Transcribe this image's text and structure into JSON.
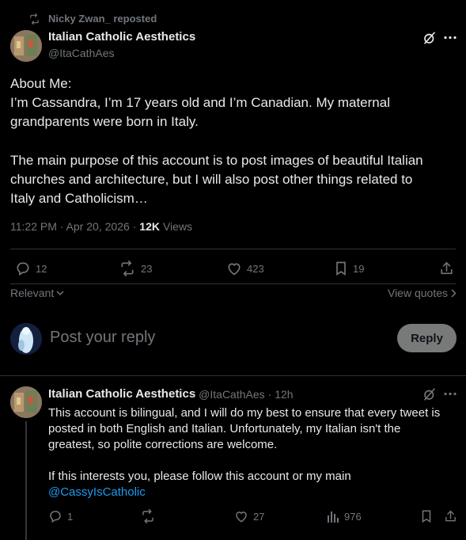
{
  "repost": {
    "text": "Nicky Zwan_ reposted"
  },
  "main_post": {
    "author_name": "Italian Catholic Aesthetics",
    "author_handle": "@ItaCathAes",
    "body_lines": [
      "About Me:",
      "I’m Cassandra, I’m 17 years old and I’m Canadian. My maternal",
      "grandparents were born in Italy.",
      "",
      "The main purpose of this account is to post images of beautiful Italian",
      "churches and architecture, but I will also post other things related to",
      "Italy and Catholicism…"
    ],
    "timestamp": "11:22 PM · Apr 20, 2026 ·",
    "views_count": "12K",
    "views_label": "Views",
    "replies": "12",
    "reposts": "23",
    "likes": "423",
    "bookmarks": "19"
  },
  "sort": {
    "label": "Relevant",
    "view_quotes": "View quotes"
  },
  "composer": {
    "placeholder": "Post your reply",
    "reply_button": "Reply"
  },
  "reply_post": {
    "author_name": "Italian Catholic Aesthetics",
    "author_handle": "@ItaCathAes",
    "time": "· 12h",
    "body_lines": [
      "This account is bilingual, and I will do my best to ensure that every tweet is",
      "posted in both English and Italian. Unfortunately, my Italian isn't the",
      "greatest, so polite corrections are welcome.",
      "",
      "If this interests you, please follow this account or my main"
    ],
    "mention": "@CassyIsCatholic",
    "replies": "1",
    "reposts": "",
    "likes": "27",
    "views": "976"
  },
  "colors": {
    "background": "#000000",
    "text": "#e7e9ea",
    "muted": "#71767b",
    "link": "#1d9bf0",
    "divider": "#2f3336"
  }
}
